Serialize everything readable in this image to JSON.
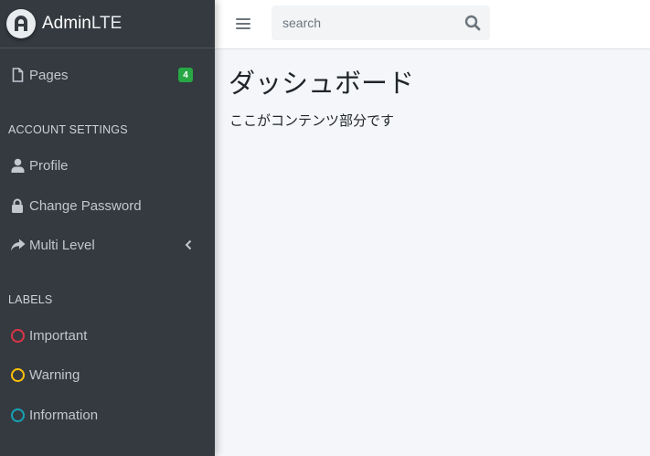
{
  "brand": {
    "name_bold": "Admin",
    "name_light": "LTE"
  },
  "sidebar": {
    "pages": {
      "label": "Pages",
      "badge": "4",
      "icon": "file-icon"
    },
    "account_header": "ACCOUNT SETTINGS",
    "account_items": [
      {
        "label": "Profile",
        "icon": "user-icon"
      },
      {
        "label": "Change Password",
        "icon": "lock-icon"
      },
      {
        "label": "Multi Level",
        "icon": "share-icon"
      }
    ],
    "labels_header": "LABELS",
    "label_items": [
      {
        "label": "Important",
        "color": "#dc3545"
      },
      {
        "label": "Warning",
        "color": "#ffc107"
      },
      {
        "label": "Information",
        "color": "#17a2b8"
      }
    ]
  },
  "topbar": {
    "search_placeholder": "search"
  },
  "content": {
    "title": "ダッシュボード",
    "body": "ここがコンテンツ部分です"
  }
}
